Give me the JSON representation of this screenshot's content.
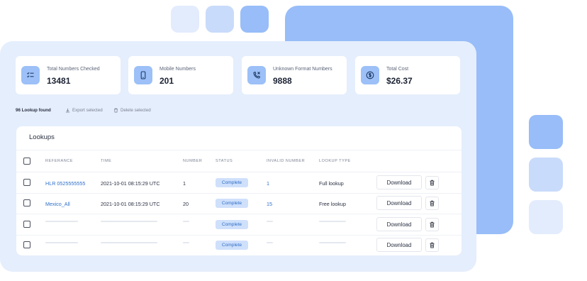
{
  "stats": [
    {
      "label": "Total Numbers Checked",
      "value": "13481",
      "icon": "list-check-icon"
    },
    {
      "label": "Mobile Numbers",
      "value": "201",
      "icon": "phone-icon"
    },
    {
      "label": "Unknown Format Numbers",
      "value": "9888",
      "icon": "phone-missed-icon"
    },
    {
      "label": "Total Cost",
      "value": "$26.37",
      "icon": "dollar-icon"
    }
  ],
  "toolbar": {
    "found": "96 Lookup found",
    "export_label": "Export selected",
    "delete_label": "Delete selected"
  },
  "table": {
    "title": "Lookups",
    "columns": [
      "REFERANCE",
      "TIME",
      "NUMBER",
      "STATUS",
      "INVALID NUMBER",
      "LOOKUP TYPE"
    ],
    "download_label": "Download",
    "rows": [
      {
        "reference": "HLR 0525555555",
        "time": "2021-10-01 08:15:29 UTC",
        "number": "1",
        "status": "Complete",
        "invalid": "1",
        "type": "Full lookup"
      },
      {
        "reference": "Mexico_All",
        "time": "2021-10-01 08:15:29 UTC",
        "number": "20",
        "status": "Complete",
        "invalid": "15",
        "type": "Free lookup"
      },
      {
        "reference": "",
        "time": "",
        "number": "",
        "status": "Complete",
        "invalid": "",
        "type": ""
      },
      {
        "reference": "",
        "time": "",
        "number": "",
        "status": "Complete",
        "invalid": "",
        "type": ""
      }
    ]
  },
  "colors": {
    "accent": "#98bdf8",
    "panel": "#e5eefc",
    "link": "#2f6fca",
    "badge": "#cfe0fb"
  }
}
